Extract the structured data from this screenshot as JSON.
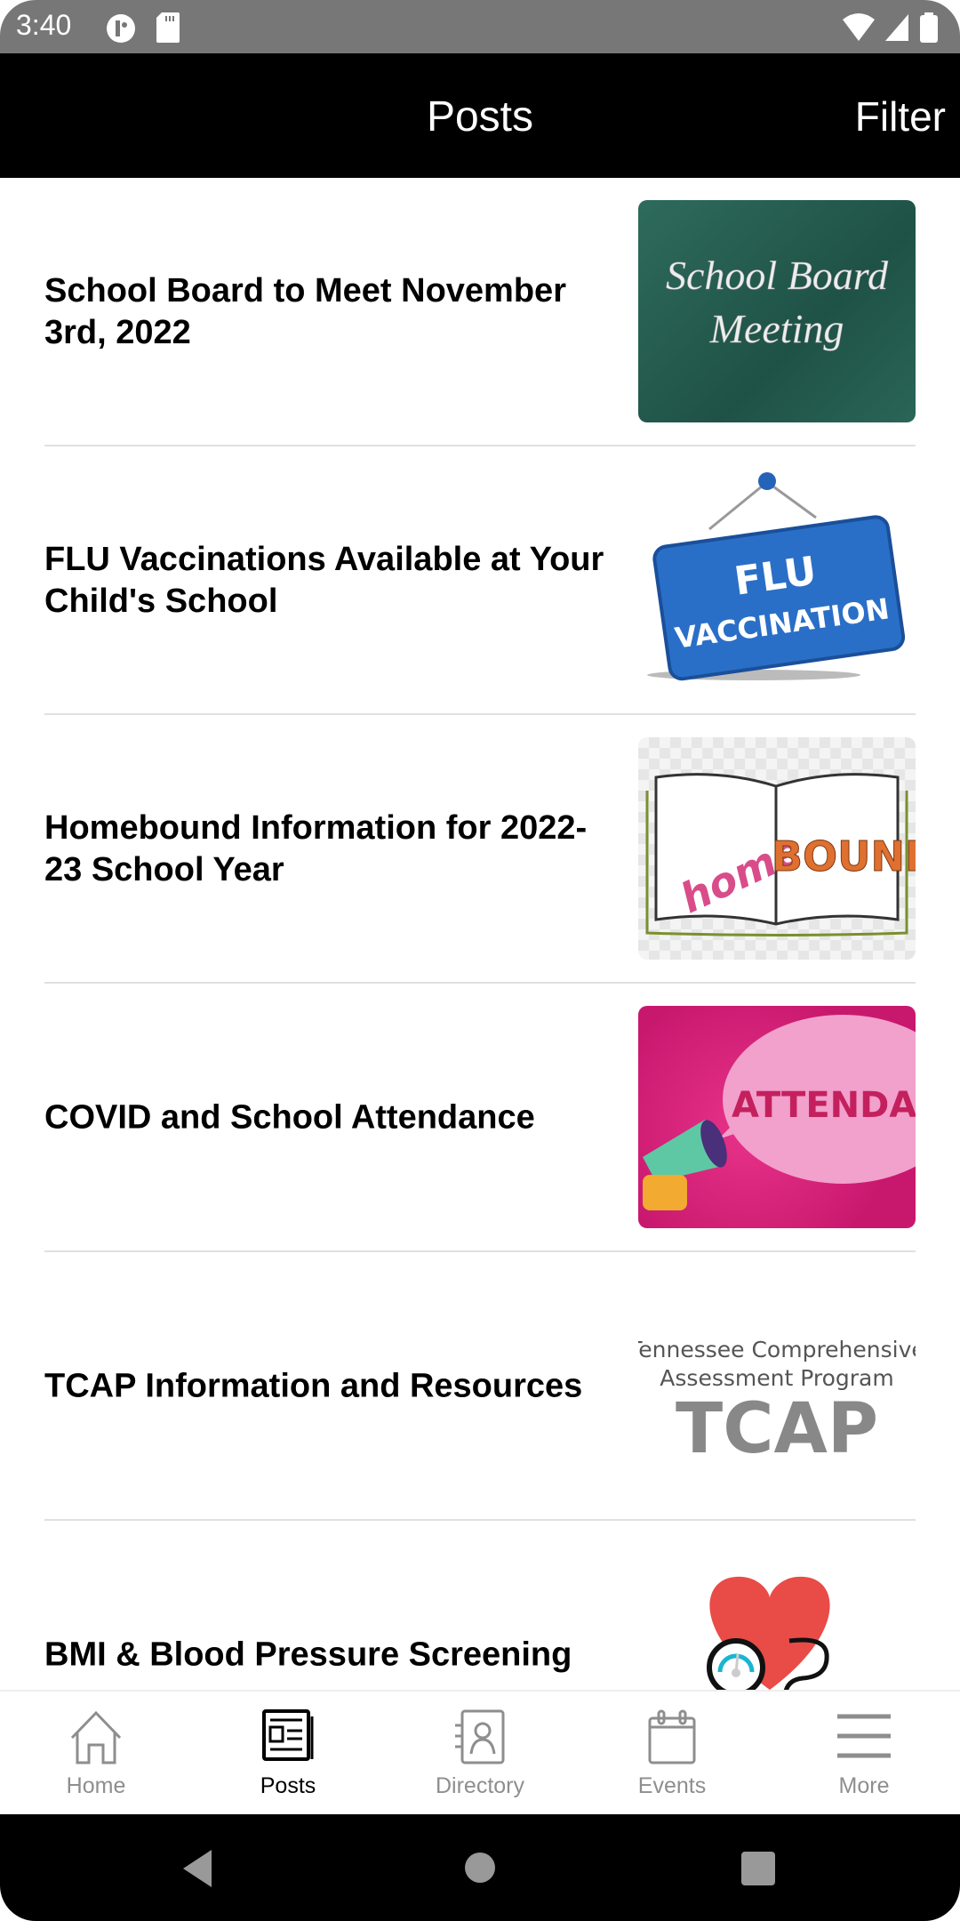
{
  "status_bar": {
    "time": "3:40",
    "left_icons": [
      "circle-app-icon",
      "sd-card-icon"
    ],
    "right_icons": [
      "wifi-icon",
      "signal-icon",
      "battery-icon"
    ]
  },
  "header": {
    "title": "Posts",
    "filter_label": "Filter"
  },
  "posts": [
    {
      "title": "School Board to Meet November 3rd, 2022",
      "image_text": [
        "School Board",
        "Meeting"
      ],
      "image_name": "school-board-meeting-image"
    },
    {
      "title": "FLU Vaccinations Available at Your Child's School",
      "image_text": [
        "FLU",
        "VACCINATION"
      ],
      "image_name": "flu-vaccination-image"
    },
    {
      "title": "Homebound Information for 2022-23 School Year",
      "image_text": [
        "home",
        "BOUND"
      ],
      "image_name": "homebound-image"
    },
    {
      "title": "COVID and School Attendance",
      "image_text": [
        "ATTENDANCE"
      ],
      "image_name": "attendance-image"
    },
    {
      "title": "TCAP Information and Resources",
      "image_text": [
        "Tennessee Comprehensive",
        "Assessment Program",
        "TCAP"
      ],
      "image_name": "tcap-image"
    },
    {
      "title": "BMI & Blood Pressure Screening",
      "image_text": [],
      "image_name": "blood-pressure-image"
    }
  ],
  "bottom_nav": {
    "items": [
      {
        "label": "Home",
        "icon": "home-icon",
        "active": false
      },
      {
        "label": "Posts",
        "icon": "newspaper-icon",
        "active": true
      },
      {
        "label": "Directory",
        "icon": "contacts-book-icon",
        "active": false
      },
      {
        "label": "Events",
        "icon": "calendar-icon",
        "active": false
      },
      {
        "label": "More",
        "icon": "hamburger-menu-icon",
        "active": false
      }
    ]
  },
  "colors": {
    "header_bg": "#000000",
    "status_bar_bg": "#777777",
    "nav_inactive": "#8e8e8e",
    "nav_active": "#000000",
    "divider": "#e0e0e0"
  }
}
